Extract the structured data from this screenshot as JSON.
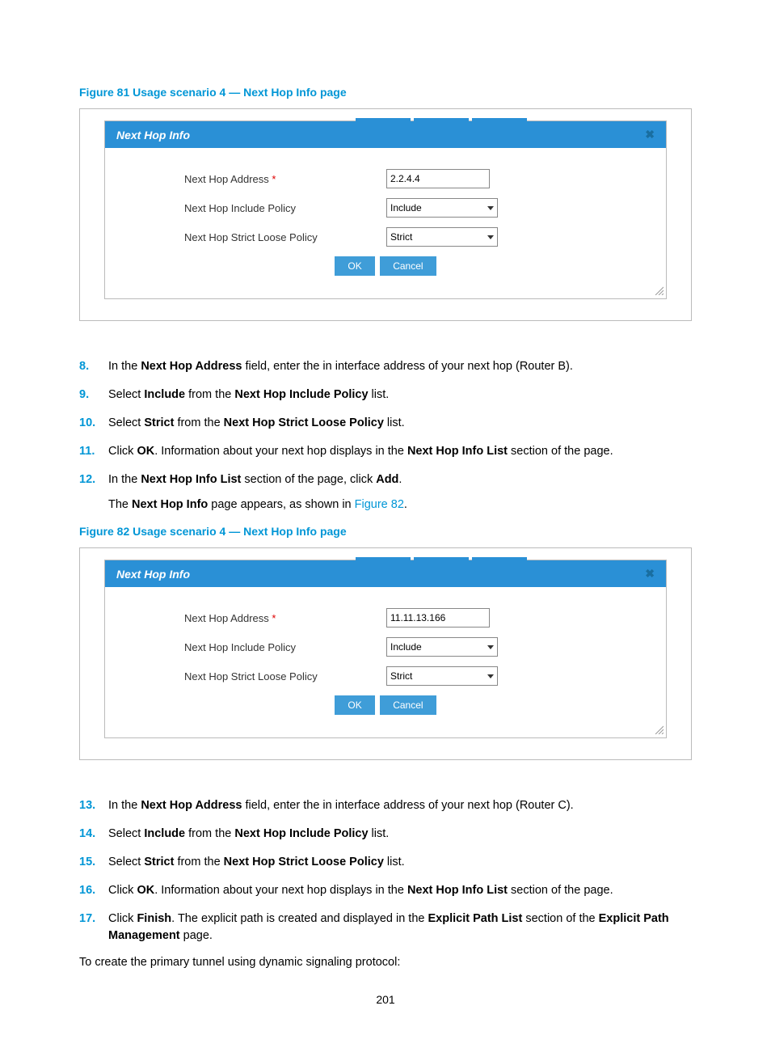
{
  "figure81": {
    "caption": "Figure 81 Usage scenario 4 — Next Hop Info page",
    "dialog": {
      "title": "Next Hop Info",
      "labels": {
        "address": "Next Hop Address",
        "include": "Next Hop Include Policy",
        "strict": "Next Hop Strict Loose Policy"
      },
      "values": {
        "address": "2.2.4.4",
        "include": "Include",
        "strict": "Strict"
      },
      "buttons": {
        "ok": "OK",
        "cancel": "Cancel"
      }
    }
  },
  "steps_a": [
    {
      "n": "8.",
      "parts": [
        "In the ",
        "Next Hop Address",
        " field, enter the in interface address of your next hop (Router B)."
      ]
    },
    {
      "n": "9.",
      "parts": [
        "Select ",
        "Include",
        " from the ",
        "Next Hop Include Policy",
        " list."
      ]
    },
    {
      "n": "10.",
      "parts": [
        "Select ",
        "Strict",
        " from the ",
        "Next Hop Strict Loose Policy",
        " list."
      ]
    },
    {
      "n": "11.",
      "parts": [
        "Click ",
        "OK",
        ". Information about your next hop displays in the ",
        "Next Hop Info List",
        " section of the page."
      ]
    },
    {
      "n": "12.",
      "parts": [
        "In the ",
        "Next Hop Info List",
        " section of the page, click ",
        "Add",
        "."
      ],
      "sub_pre": "The ",
      "sub_bold": "Next Hop Info",
      "sub_mid": " page appears, as shown in ",
      "sub_link": "Figure 82",
      "sub_post": "."
    }
  ],
  "figure82": {
    "caption": "Figure 82 Usage scenario 4 — Next Hop Info page",
    "dialog": {
      "title": "Next Hop Info",
      "labels": {
        "address": "Next Hop Address",
        "include": "Next Hop Include Policy",
        "strict": "Next Hop Strict Loose Policy"
      },
      "values": {
        "address": "11.11.13.166",
        "include": "Include",
        "strict": "Strict"
      },
      "buttons": {
        "ok": "OK",
        "cancel": "Cancel"
      }
    }
  },
  "steps_b": [
    {
      "n": "13.",
      "parts": [
        "In the ",
        "Next Hop Address",
        " field, enter the in interface address of your next hop (Router C)."
      ]
    },
    {
      "n": "14.",
      "parts": [
        "Select ",
        "Include",
        " from the ",
        "Next Hop Include Policy",
        " list."
      ]
    },
    {
      "n": "15.",
      "parts": [
        "Select ",
        "Strict",
        " from the ",
        "Next Hop Strict Loose Policy",
        " list."
      ]
    },
    {
      "n": "16.",
      "parts": [
        "Click ",
        "OK",
        ". Information about your next hop displays in the ",
        "Next Hop Info List",
        " section of the page."
      ]
    },
    {
      "n": "17.",
      "parts": [
        "Click ",
        "Finish",
        ". The explicit path is created and displayed in the ",
        "Explicit Path List",
        " section of the ",
        "Explicit Path Management",
        " page."
      ]
    }
  ],
  "after_text": "To create the primary tunnel using dynamic signaling protocol:",
  "page_number": "201"
}
